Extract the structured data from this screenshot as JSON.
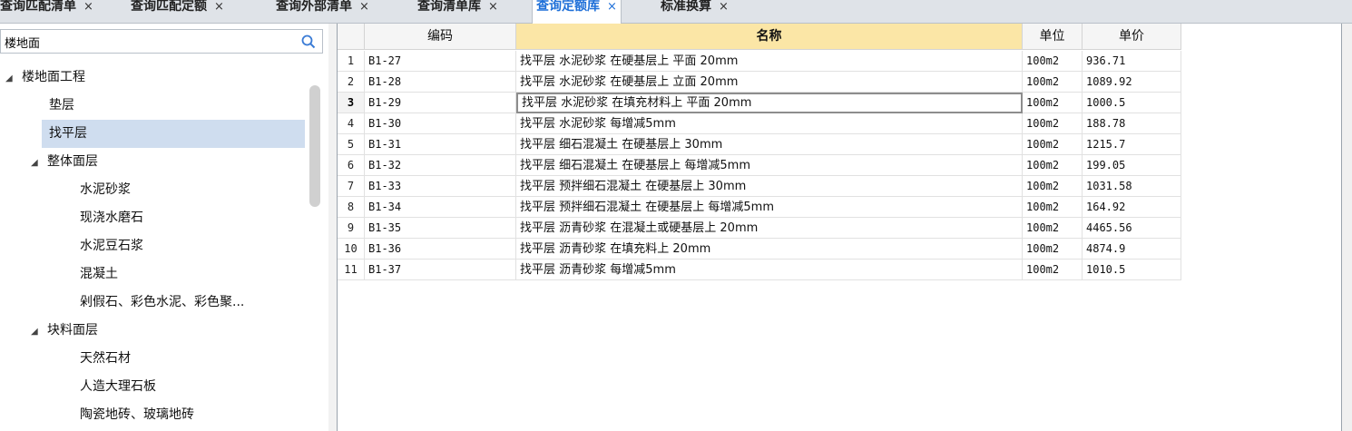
{
  "tabs": [
    {
      "label": "查询匹配清单",
      "close": "×",
      "active": false
    },
    {
      "label": "查询匹配定额",
      "close": "×",
      "active": false
    },
    {
      "label": "查询外部清单",
      "close": "×",
      "active": false
    },
    {
      "label": "查询清单库",
      "close": "×",
      "active": false
    },
    {
      "label": "查询定额库",
      "close": "×",
      "active": true
    },
    {
      "label": "标准换算",
      "close": "×",
      "active": false
    }
  ],
  "search": {
    "value": "楼地面",
    "icon": "search-icon"
  },
  "tree": [
    {
      "label": "楼地面工程",
      "level": 0,
      "expanded": true
    },
    {
      "label": "垫层",
      "level": 1
    },
    {
      "label": "找平层",
      "level": 1,
      "selected": true
    },
    {
      "label": "整体面层",
      "level": 1,
      "expanded": true
    },
    {
      "label": "水泥砂浆",
      "level": 2
    },
    {
      "label": "现浇水磨石",
      "level": 2
    },
    {
      "label": "水泥豆石浆",
      "level": 2
    },
    {
      "label": "混凝土",
      "level": 2
    },
    {
      "label": "剁假石、彩色水泥、彩色聚...",
      "level": 2
    },
    {
      "label": "块料面层",
      "level": 1,
      "expanded": true
    },
    {
      "label": "天然石材",
      "level": 2
    },
    {
      "label": "人造大理石板",
      "level": 2
    },
    {
      "label": "陶瓷地砖、玻璃地砖",
      "level": 2
    }
  ],
  "grid": {
    "headers": {
      "code": "编码",
      "name": "名称",
      "unit": "单位",
      "price": "单价"
    },
    "current_row": 3,
    "rows": [
      {
        "num": "1",
        "code": "B1-27",
        "name": "找平层 水泥砂浆 在硬基层上 平面 20mm",
        "unit": "100m2",
        "price": "936.71"
      },
      {
        "num": "2",
        "code": "B1-28",
        "name": "找平层 水泥砂浆 在硬基层上 立面 20mm",
        "unit": "100m2",
        "price": "1089.92"
      },
      {
        "num": "3",
        "code": "B1-29",
        "name": "找平层 水泥砂浆 在填充材料上 平面 20mm",
        "unit": "100m2",
        "price": "1000.5"
      },
      {
        "num": "4",
        "code": "B1-30",
        "name": "找平层 水泥砂浆 每增减5mm",
        "unit": "100m2",
        "price": "188.78"
      },
      {
        "num": "5",
        "code": "B1-31",
        "name": "找平层 细石混凝土 在硬基层上 30mm",
        "unit": "100m2",
        "price": "1215.7"
      },
      {
        "num": "6",
        "code": "B1-32",
        "name": "找平层 细石混凝土 在硬基层上 每增减5mm",
        "unit": "100m2",
        "price": "199.05"
      },
      {
        "num": "7",
        "code": "B1-33",
        "name": "找平层 预拌细石混凝土 在硬基层上 30mm",
        "unit": "100m2",
        "price": "1031.58"
      },
      {
        "num": "8",
        "code": "B1-34",
        "name": "找平层 预拌细石混凝土 在硬基层上 每增减5mm",
        "unit": "100m2",
        "price": "164.92"
      },
      {
        "num": "9",
        "code": "B1-35",
        "name": "找平层 沥青砂浆 在混凝土或硬基层上 20mm",
        "unit": "100m2",
        "price": "4465.56"
      },
      {
        "num": "10",
        "code": "B1-36",
        "name": "找平层 沥青砂浆 在填充料上 20mm",
        "unit": "100m2",
        "price": "4874.9"
      },
      {
        "num": "11",
        "code": "B1-37",
        "name": "找平层 沥青砂浆 每增减5mm",
        "unit": "100m2",
        "price": "1010.5"
      }
    ]
  },
  "colors": {
    "active_tab_text": "#1e6fd8",
    "name_header_bg": "#fbe6a6",
    "tree_selected_bg": "#cfddef"
  }
}
